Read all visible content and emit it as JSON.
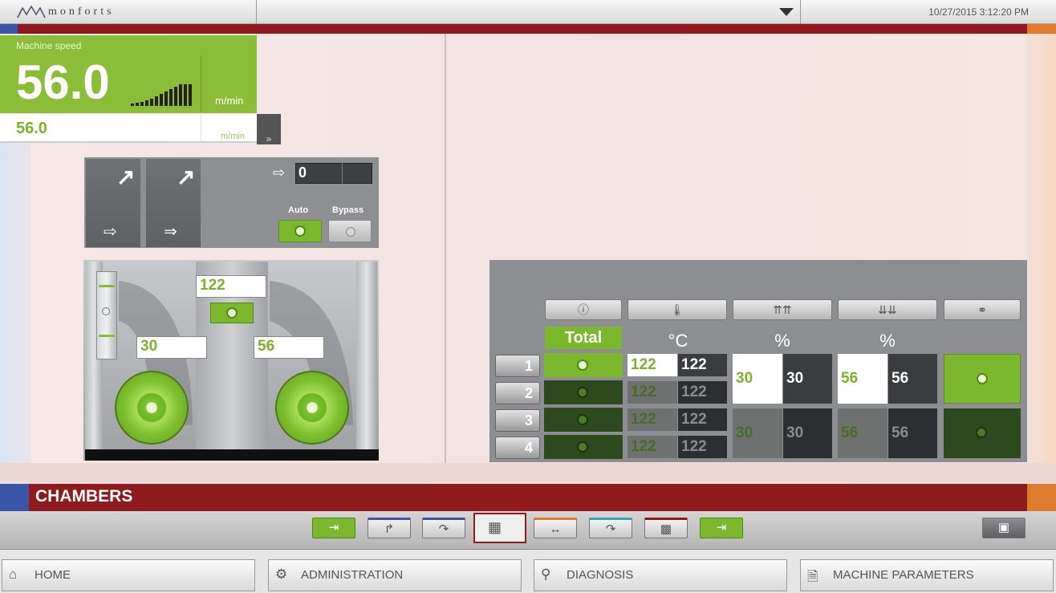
{
  "header": {
    "logo_text": "monforts",
    "datetime": "10/27/2015 3:12:20 PM",
    "dropdown_icon": "triangle-down-icon"
  },
  "colors": {
    "brand_red": "#8e1a1e",
    "accent_green": "#8cbd39",
    "accent_blue": "#3a54a8",
    "accent_orange": "#e07a2c"
  },
  "speed": {
    "label": "Machine speed",
    "value": "56.0",
    "unit": "m/min",
    "setpoint": "56.0",
    "setpoint_unit": "m/min",
    "go_icon": "double-chevron-right-icon"
  },
  "control": {
    "counter_value": "0",
    "auto_label": "Auto",
    "bypass_label": "Bypass"
  },
  "chamber_diagram": {
    "top_temp": "122",
    "left_value": "30",
    "right_value": "56"
  },
  "table": {
    "column_icons": [
      "info-icon",
      "thermometer-icon",
      "upper-nozzle-icon",
      "lower-nozzle-icon",
      "circulation-icon"
    ],
    "total_label": "Total",
    "temp_unit": "°C",
    "pct_unit_1": "%",
    "pct_unit_2": "%",
    "rows": [
      {
        "label": "1",
        "temp_set": "122",
        "temp_act": "122"
      },
      {
        "label": "2",
        "temp_set": "122",
        "temp_act": "122"
      },
      {
        "label": "3",
        "temp_set": "122",
        "temp_act": "122"
      },
      {
        "label": "4",
        "temp_set": "122",
        "temp_act": "122"
      }
    ],
    "group_a": {
      "upper_set": "30",
      "upper_act": "30",
      "lower_set": "56",
      "lower_act": "56"
    },
    "group_b": {
      "upper_set": "30",
      "upper_act": "30",
      "lower_set": "56",
      "lower_act": "56"
    }
  },
  "section": {
    "title": "CHAMBERS"
  },
  "nav": {
    "home": "HOME",
    "administration": "ADMINISTRATION",
    "diagnosis": "DIAGNOSIS",
    "machine_parameters": "MACHINE PARAMETERS"
  }
}
